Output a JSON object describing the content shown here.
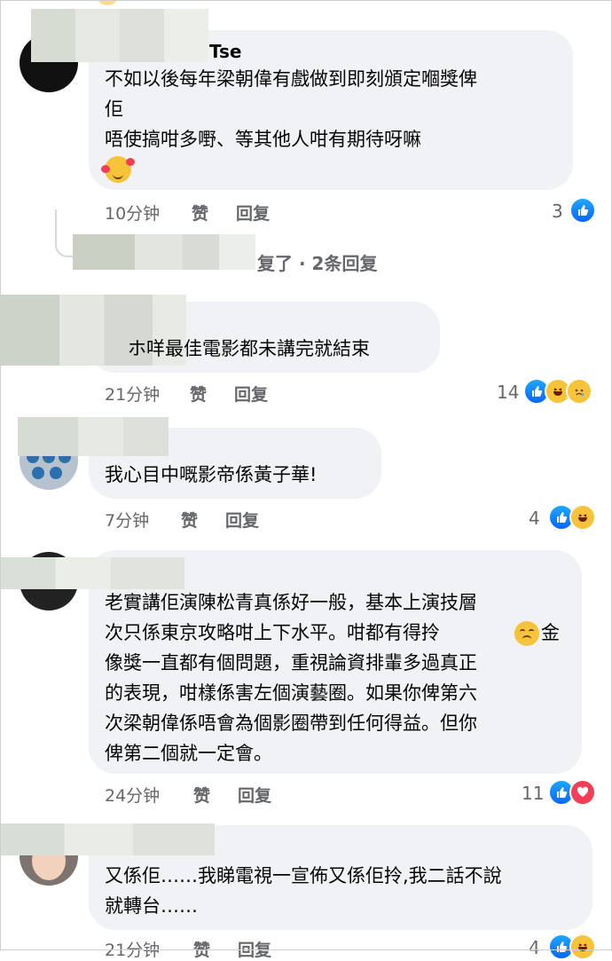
{
  "comments": [
    {
      "name_fragment": "Tse",
      "lines": [
        "不如以後每年梁朝偉有戲做到即刻頒定嗰獎俾",
        "佢",
        "唔使搞咁多嘢、等其他人咁有期待呀嘛"
      ],
      "time": "10分钟",
      "like_label": "赞",
      "reply_label": "回复",
      "reaction_count": "3",
      "reactions": [
        "like-icon"
      ]
    },
    {
      "reply_summary": "复了 · 2条回复"
    },
    {
      "lines": [
        "ホ咩最佳電影都未講完就結束"
      ],
      "time": "21分钟",
      "like_label": "赞",
      "reply_label": "回复",
      "reaction_count": "14",
      "reactions": [
        "like-icon",
        "haha-icon",
        "sad-icon"
      ]
    },
    {
      "lines": [
        "我心目中嘅影帝係黃子華!"
      ],
      "time": "7分钟",
      "like_label": "赞",
      "reply_label": "回复",
      "reaction_count": "4",
      "reactions": [
        "like-icon",
        "haha-icon"
      ]
    },
    {
      "lines": [
        "老實講佢演陳松青真係好一般，基本上演技層",
        "次只係東京攻略咁上下水平。咁都有得拎",
        "像獎一直都有個問題，重視論資排輩多過真正",
        "的表現，咁樣係害左個演藝圈。如果你俾第六",
        "次梁朝偉係唔會為個影圈帶到任何得益。但你",
        "俾第二個就一定會。"
      ],
      "inline_tail": "金",
      "time": "24分钟",
      "like_label": "赞",
      "reply_label": "回复",
      "reaction_count": "11",
      "reactions": [
        "like-icon",
        "love-icon"
      ]
    },
    {
      "lines": [
        "又係佢……我睇電視一宣佈又係佢拎,我二話不說",
        "就轉台……"
      ],
      "time": "21分钟",
      "like_label": "赞",
      "reply_label": "回复",
      "reaction_count": "4",
      "reactions": [
        "like-icon",
        "haha-icon"
      ]
    }
  ],
  "colors": {
    "bubble": "#f0f2f5",
    "meta_text": "#65676b",
    "like_blue": "#0866ff",
    "haha_yellow": "#f7c33b",
    "love_red": "#f33e58"
  }
}
